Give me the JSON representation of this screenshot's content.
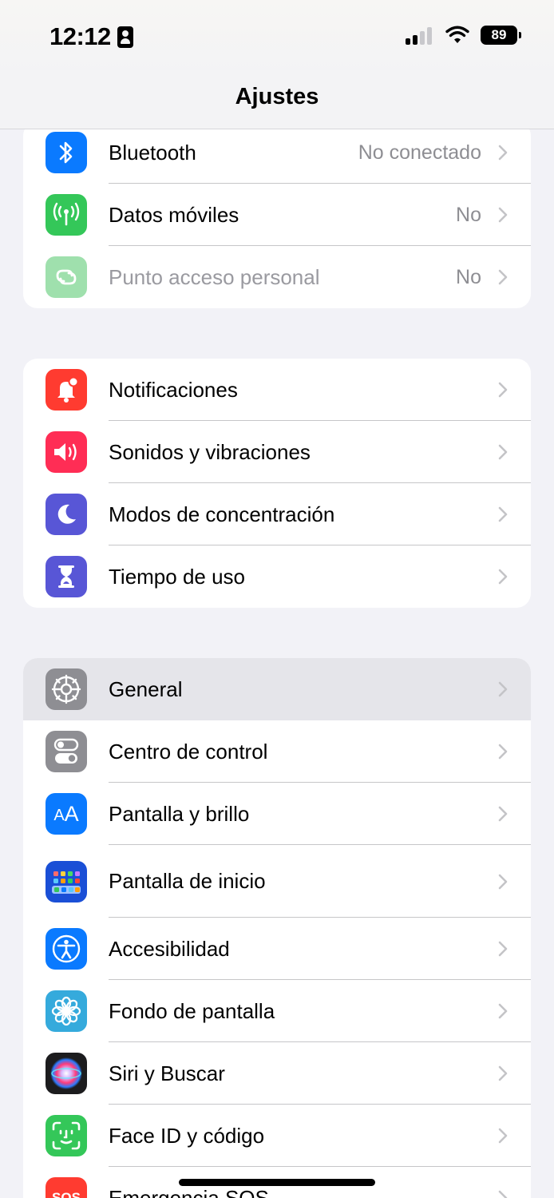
{
  "status_bar": {
    "time": "12:12",
    "battery": "89"
  },
  "nav": {
    "title": "Ajustes"
  },
  "groups": [
    {
      "rows": [
        {
          "label": "Bluetooth",
          "value": "No conectado",
          "icon": "bluetooth-icon",
          "color": "#0a7aff"
        },
        {
          "label": "Datos móviles",
          "value": "No",
          "icon": "antenna-icon",
          "color": "#34c759"
        },
        {
          "label": "Punto acceso personal",
          "value": "No",
          "icon": "hotspot-link-icon",
          "color": "#9fe0ad"
        }
      ]
    },
    {
      "rows": [
        {
          "label": "Notificaciones",
          "icon": "bell-icon",
          "color": "#ff3b30"
        },
        {
          "label": "Sonidos y vibraciones",
          "icon": "speaker-icon",
          "color": "#ff2d55"
        },
        {
          "label": "Modos de concentración",
          "icon": "moon-icon",
          "color": "#5856d6"
        },
        {
          "label": "Tiempo de uso",
          "icon": "hourglass-icon",
          "color": "#5856d6"
        }
      ]
    },
    {
      "rows": [
        {
          "label": "General",
          "icon": "gear-icon",
          "color": "#8e8e93",
          "highlighted": true
        },
        {
          "label": "Centro de control",
          "icon": "toggles-icon",
          "color": "#8e8e93"
        },
        {
          "label": "Pantalla y brillo",
          "icon": "text-size-icon",
          "color": "#0a7aff",
          "glyph": "AA"
        },
        {
          "label": "Pantalla de inicio",
          "icon": "home-grid-icon",
          "color": "#1a4fd6"
        },
        {
          "label": "Accesibilidad",
          "icon": "accessibility-icon",
          "color": "#0a7aff"
        },
        {
          "label": "Fondo de pantalla",
          "icon": "flower-icon",
          "color": "#35aadc"
        },
        {
          "label": "Siri y Buscar",
          "icon": "siri-icon",
          "color": "#1c1c1e"
        },
        {
          "label": "Face ID y código",
          "icon": "face-id-icon",
          "color": "#34c759"
        },
        {
          "label": "Emergencia SOS",
          "icon": "sos-icon",
          "color": "#ff3b30",
          "glyph": "SOS"
        }
      ]
    }
  ]
}
